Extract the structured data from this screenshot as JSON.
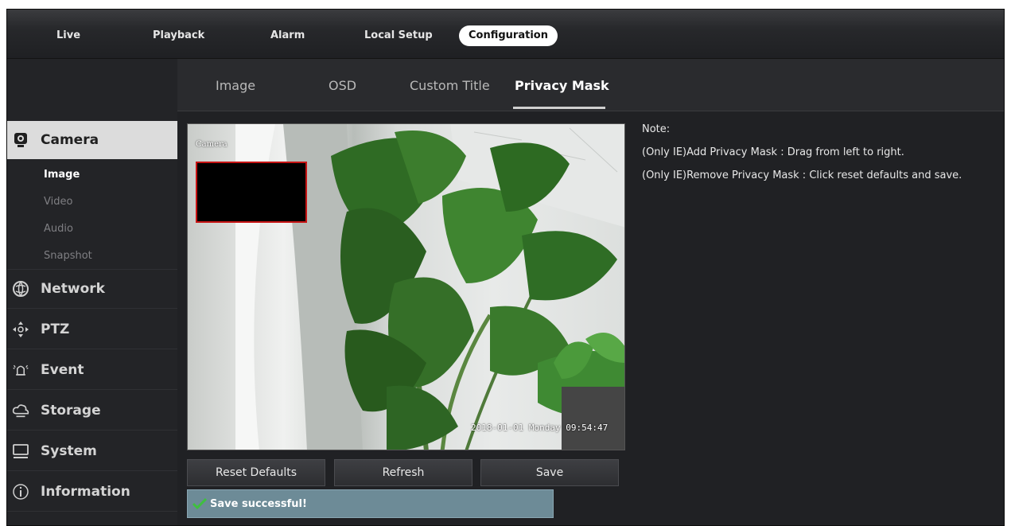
{
  "topnav": {
    "items": [
      "Live",
      "Playback",
      "Alarm",
      "Local Setup",
      "Configuration"
    ]
  },
  "sidebar": {
    "camera": "Camera",
    "sub_items": [
      "Image",
      "Video",
      "Audio",
      "Snapshot"
    ],
    "categories": [
      "Network",
      "PTZ",
      "Event",
      "Storage",
      "System",
      "Information"
    ]
  },
  "tabs": [
    "Image",
    "OSD",
    "Custom Title",
    "Privacy Mask"
  ],
  "video": {
    "camera_label": "Camera",
    "osd_time": "2018-01-01 Monday 09:54:47"
  },
  "buttons": {
    "reset": "Reset Defaults",
    "refresh": "Refresh",
    "save": "Save"
  },
  "status": {
    "text": "Save successful!"
  },
  "notes": {
    "title": "Note:",
    "add": "(Only IE)Add Privacy Mask : Drag from left to right.",
    "remove": "(Only IE)Remove Privacy Mask : Click reset defaults and save."
  },
  "colors": {
    "mask_border": "#c71414",
    "status_bg": "#6d8b97",
    "check_green": "#3fbf3f"
  }
}
